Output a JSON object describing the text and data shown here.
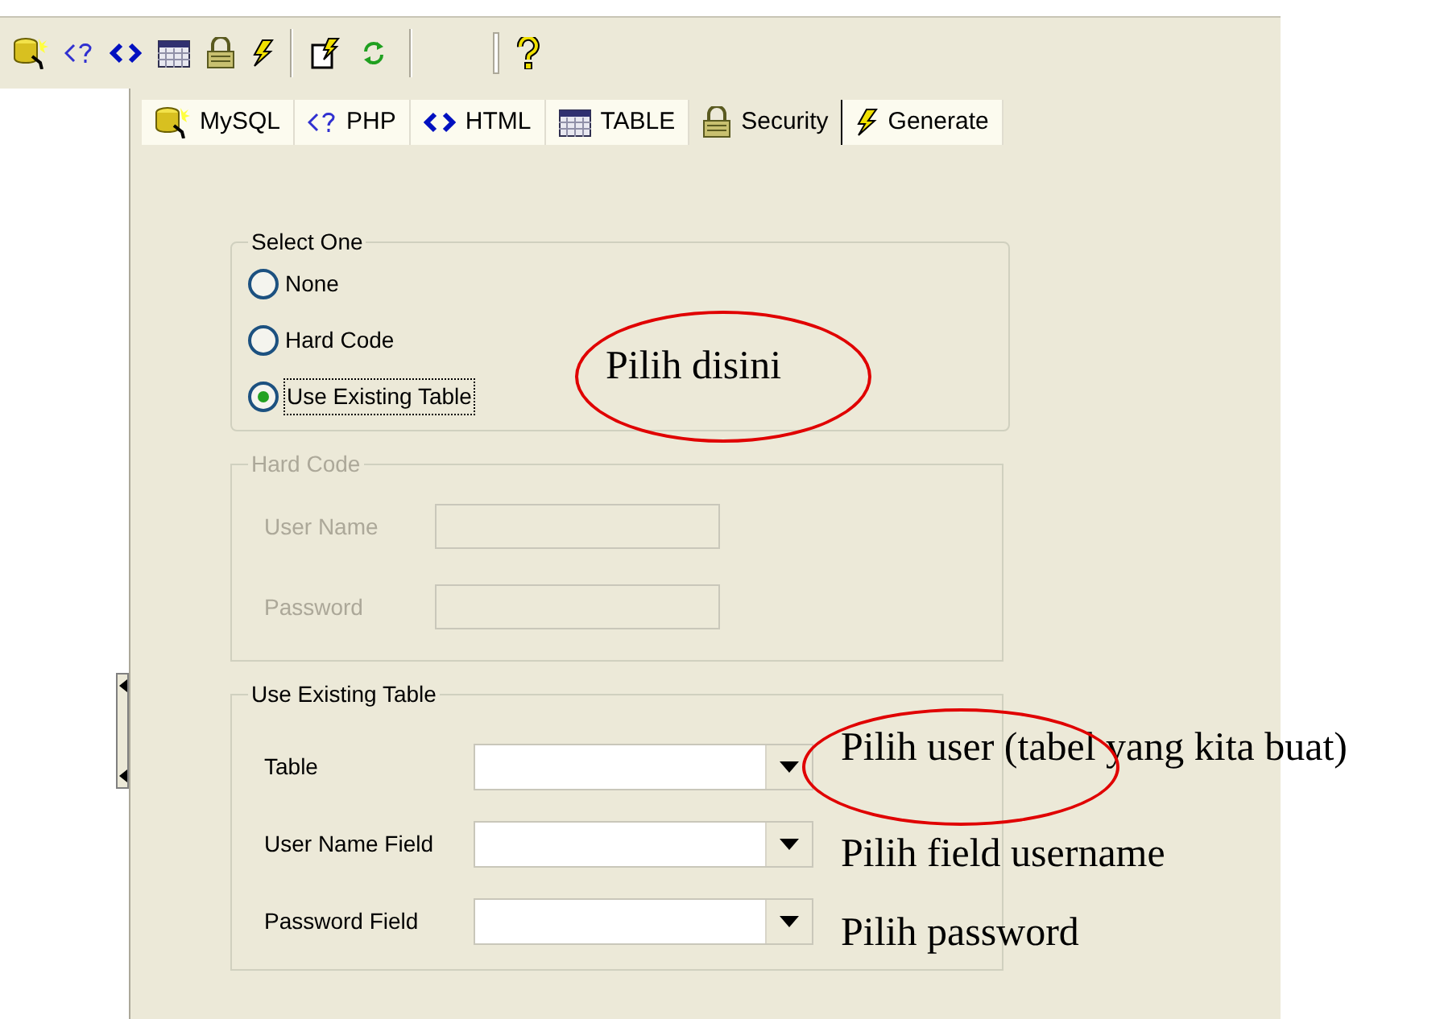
{
  "tabs": [
    {
      "label": "MySQL",
      "selected": false
    },
    {
      "label": "PHP",
      "selected": false
    },
    {
      "label": "HTML",
      "selected": false
    },
    {
      "label": "TABLE",
      "selected": false
    },
    {
      "label": "Security",
      "selected": true
    },
    {
      "label": "Generate",
      "selected": false
    }
  ],
  "select_one": {
    "legend": "Select One",
    "options": [
      {
        "label": "None",
        "selected": false
      },
      {
        "label": "Hard Code",
        "selected": false
      },
      {
        "label": "Use Existing Table",
        "selected": true
      }
    ]
  },
  "hard_code": {
    "legend": "Hard Code",
    "disabled": true,
    "fields": [
      {
        "label": "User Name"
      },
      {
        "label": "Password"
      }
    ]
  },
  "use_existing_table": {
    "legend": "Use Existing Table",
    "disabled": false,
    "fields": [
      {
        "label": "Table"
      },
      {
        "label": "User Name Field"
      },
      {
        "label": "Password Field"
      }
    ]
  },
  "annotations": [
    {
      "text": "Pilih disini",
      "circled": true
    },
    {
      "text": "Pilih user (tabel yang kita buat)",
      "circled": true
    },
    {
      "text": "Pilih field username",
      "circled": false
    },
    {
      "text": "Pilih password",
      "circled": false
    }
  ]
}
